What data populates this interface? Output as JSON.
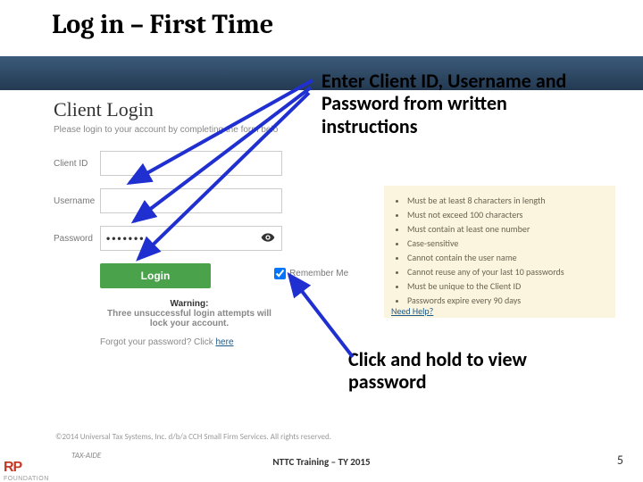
{
  "title": "Log in – First Time",
  "login": {
    "heading": "Client Login",
    "subtext": "Please login to your account by completing the form belo",
    "labels": {
      "clientid": "Client ID",
      "username": "Username",
      "password": "Password"
    },
    "passwordValue": "•••••••",
    "loginBtn": "Login",
    "remember": "Remember Me",
    "warnTitle": "Warning:",
    "warnText": "Three unsuccessful login attempts will lock your account.",
    "forgotPrefix": "Forgot your password? Click ",
    "forgotLink": "here"
  },
  "rules": [
    "Must be at least 8 characters in length",
    "Must not exceed 100 characters",
    "Must contain at least one number",
    "Case-sensitive",
    "Cannot contain the user name",
    "Cannot reuse any of your last 10 passwords",
    "Must be unique to the Client ID",
    "Passwords expire every 90 days"
  ],
  "needHelp": "Need Help?",
  "callout1": "Enter Client ID, Username and Password from written instructions",
  "callout2": "Click and hold to view password",
  "copyright": "©2014 Universal Tax Systems, Inc. d/b/a CCH Small Firm Services. All rights reserved.",
  "footer": {
    "brandRed": "RP",
    "brandFound": "FOUNDATION",
    "taxaide": "TAX-AIDE",
    "center": "NTTC Training – TY 2015",
    "pageNum": "5"
  }
}
